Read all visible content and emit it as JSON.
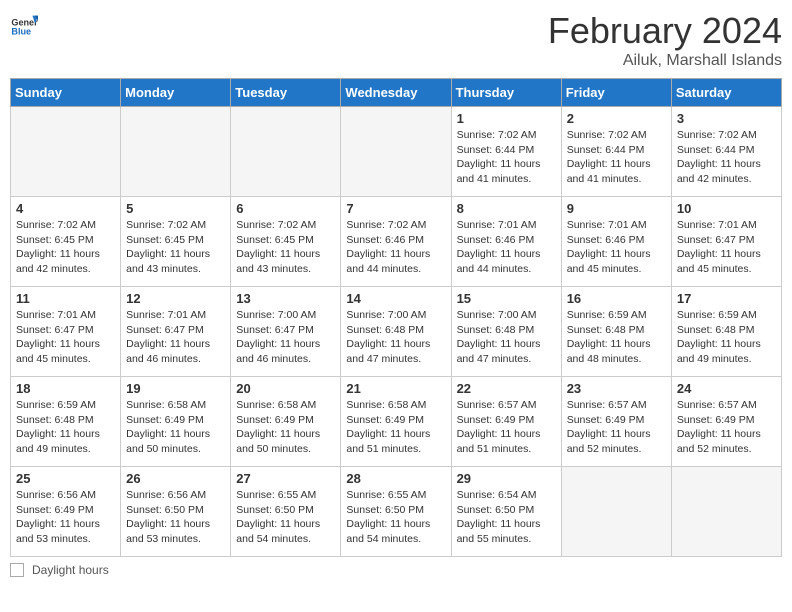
{
  "header": {
    "logo_general": "General",
    "logo_blue": "Blue",
    "title": "February 2024",
    "subtitle": "Ailuk, Marshall Islands"
  },
  "weekdays": [
    "Sunday",
    "Monday",
    "Tuesday",
    "Wednesday",
    "Thursday",
    "Friday",
    "Saturday"
  ],
  "weeks": [
    [
      {
        "day": "",
        "info": ""
      },
      {
        "day": "",
        "info": ""
      },
      {
        "day": "",
        "info": ""
      },
      {
        "day": "",
        "info": ""
      },
      {
        "day": "1",
        "info": "Sunrise: 7:02 AM\nSunset: 6:44 PM\nDaylight: 11 hours\nand 41 minutes."
      },
      {
        "day": "2",
        "info": "Sunrise: 7:02 AM\nSunset: 6:44 PM\nDaylight: 11 hours\nand 41 minutes."
      },
      {
        "day": "3",
        "info": "Sunrise: 7:02 AM\nSunset: 6:44 PM\nDaylight: 11 hours\nand 42 minutes."
      }
    ],
    [
      {
        "day": "4",
        "info": "Sunrise: 7:02 AM\nSunset: 6:45 PM\nDaylight: 11 hours\nand 42 minutes."
      },
      {
        "day": "5",
        "info": "Sunrise: 7:02 AM\nSunset: 6:45 PM\nDaylight: 11 hours\nand 43 minutes."
      },
      {
        "day": "6",
        "info": "Sunrise: 7:02 AM\nSunset: 6:45 PM\nDaylight: 11 hours\nand 43 minutes."
      },
      {
        "day": "7",
        "info": "Sunrise: 7:02 AM\nSunset: 6:46 PM\nDaylight: 11 hours\nand 44 minutes."
      },
      {
        "day": "8",
        "info": "Sunrise: 7:01 AM\nSunset: 6:46 PM\nDaylight: 11 hours\nand 44 minutes."
      },
      {
        "day": "9",
        "info": "Sunrise: 7:01 AM\nSunset: 6:46 PM\nDaylight: 11 hours\nand 45 minutes."
      },
      {
        "day": "10",
        "info": "Sunrise: 7:01 AM\nSunset: 6:47 PM\nDaylight: 11 hours\nand 45 minutes."
      }
    ],
    [
      {
        "day": "11",
        "info": "Sunrise: 7:01 AM\nSunset: 6:47 PM\nDaylight: 11 hours\nand 45 minutes."
      },
      {
        "day": "12",
        "info": "Sunrise: 7:01 AM\nSunset: 6:47 PM\nDaylight: 11 hours\nand 46 minutes."
      },
      {
        "day": "13",
        "info": "Sunrise: 7:00 AM\nSunset: 6:47 PM\nDaylight: 11 hours\nand 46 minutes."
      },
      {
        "day": "14",
        "info": "Sunrise: 7:00 AM\nSunset: 6:48 PM\nDaylight: 11 hours\nand 47 minutes."
      },
      {
        "day": "15",
        "info": "Sunrise: 7:00 AM\nSunset: 6:48 PM\nDaylight: 11 hours\nand 47 minutes."
      },
      {
        "day": "16",
        "info": "Sunrise: 6:59 AM\nSunset: 6:48 PM\nDaylight: 11 hours\nand 48 minutes."
      },
      {
        "day": "17",
        "info": "Sunrise: 6:59 AM\nSunset: 6:48 PM\nDaylight: 11 hours\nand 49 minutes."
      }
    ],
    [
      {
        "day": "18",
        "info": "Sunrise: 6:59 AM\nSunset: 6:48 PM\nDaylight: 11 hours\nand 49 minutes."
      },
      {
        "day": "19",
        "info": "Sunrise: 6:58 AM\nSunset: 6:49 PM\nDaylight: 11 hours\nand 50 minutes."
      },
      {
        "day": "20",
        "info": "Sunrise: 6:58 AM\nSunset: 6:49 PM\nDaylight: 11 hours\nand 50 minutes."
      },
      {
        "day": "21",
        "info": "Sunrise: 6:58 AM\nSunset: 6:49 PM\nDaylight: 11 hours\nand 51 minutes."
      },
      {
        "day": "22",
        "info": "Sunrise: 6:57 AM\nSunset: 6:49 PM\nDaylight: 11 hours\nand 51 minutes."
      },
      {
        "day": "23",
        "info": "Sunrise: 6:57 AM\nSunset: 6:49 PM\nDaylight: 11 hours\nand 52 minutes."
      },
      {
        "day": "24",
        "info": "Sunrise: 6:57 AM\nSunset: 6:49 PM\nDaylight: 11 hours\nand 52 minutes."
      }
    ],
    [
      {
        "day": "25",
        "info": "Sunrise: 6:56 AM\nSunset: 6:49 PM\nDaylight: 11 hours\nand 53 minutes."
      },
      {
        "day": "26",
        "info": "Sunrise: 6:56 AM\nSunset: 6:50 PM\nDaylight: 11 hours\nand 53 minutes."
      },
      {
        "day": "27",
        "info": "Sunrise: 6:55 AM\nSunset: 6:50 PM\nDaylight: 11 hours\nand 54 minutes."
      },
      {
        "day": "28",
        "info": "Sunrise: 6:55 AM\nSunset: 6:50 PM\nDaylight: 11 hours\nand 54 minutes."
      },
      {
        "day": "29",
        "info": "Sunrise: 6:54 AM\nSunset: 6:50 PM\nDaylight: 11 hours\nand 55 minutes."
      },
      {
        "day": "",
        "info": ""
      },
      {
        "day": "",
        "info": ""
      }
    ]
  ],
  "footer": {
    "legend_label": "Daylight hours"
  }
}
